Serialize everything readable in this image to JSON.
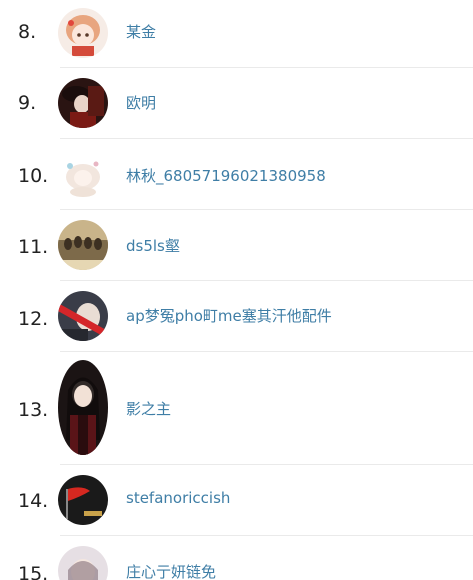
{
  "ranking_list": {
    "items": [
      {
        "rank": "8.",
        "name": "某金",
        "avatar_icon": "anime-girl-avatar"
      },
      {
        "rank": "9.",
        "name": "欧明",
        "avatar_icon": "dark-figure-avatar"
      },
      {
        "rank": "10.",
        "name": "林秋_68057196021380958",
        "avatar_icon": "pale-anime-avatar"
      },
      {
        "rank": "11.",
        "name": "ds5ls壑",
        "avatar_icon": "sepia-scene-avatar"
      },
      {
        "rank": "12.",
        "name": "ap梦冤pho町me塞其汗他配件",
        "avatar_icon": "red-sash-avatar"
      },
      {
        "rank": "13.",
        "name": "影之主",
        "avatar_icon": "long-hair-figure-avatar"
      },
      {
        "rank": "14.",
        "name": "stefanoriccish",
        "avatar_icon": "red-flag-avatar"
      },
      {
        "rank": "15.",
        "name": "庄心亍妍链免",
        "avatar_icon": "soft-portrait-avatar"
      }
    ]
  }
}
